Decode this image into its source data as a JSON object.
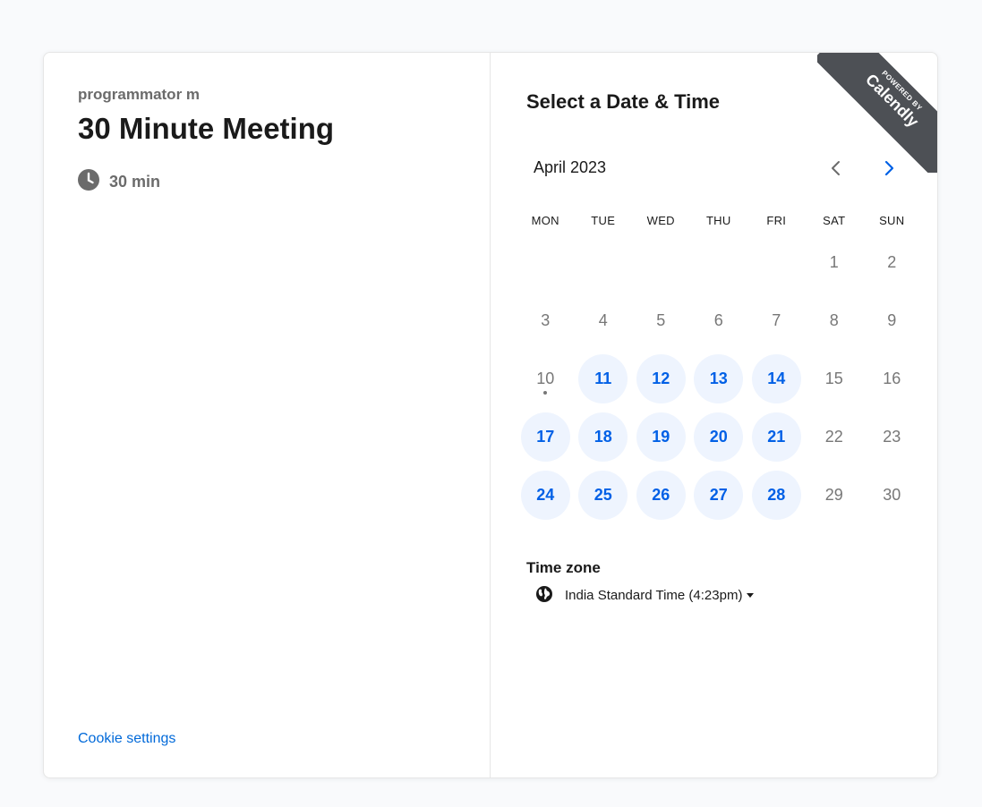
{
  "event": {
    "host": "programmator m",
    "title": "30 Minute Meeting",
    "duration": "30 min",
    "duration_icon": "clock-icon"
  },
  "footer": {
    "cookie_link": "Cookie settings"
  },
  "scheduler": {
    "title": "Select a Date & Time",
    "month": "April 2023",
    "prev_icon": "chevron-left-icon",
    "next_icon": "chevron-right-icon",
    "weekdays": [
      "MON",
      "TUE",
      "WED",
      "THU",
      "FRI",
      "SAT",
      "SUN"
    ],
    "days": [
      {
        "label": "",
        "available": false
      },
      {
        "label": "",
        "available": false
      },
      {
        "label": "",
        "available": false
      },
      {
        "label": "",
        "available": false
      },
      {
        "label": "",
        "available": false
      },
      {
        "label": "1",
        "available": false
      },
      {
        "label": "2",
        "available": false
      },
      {
        "label": "3",
        "available": false
      },
      {
        "label": "4",
        "available": false
      },
      {
        "label": "5",
        "available": false
      },
      {
        "label": "6",
        "available": false
      },
      {
        "label": "7",
        "available": false
      },
      {
        "label": "8",
        "available": false
      },
      {
        "label": "9",
        "available": false
      },
      {
        "label": "10",
        "available": false,
        "today": true
      },
      {
        "label": "11",
        "available": true
      },
      {
        "label": "12",
        "available": true
      },
      {
        "label": "13",
        "available": true
      },
      {
        "label": "14",
        "available": true
      },
      {
        "label": "15",
        "available": false
      },
      {
        "label": "16",
        "available": false
      },
      {
        "label": "17",
        "available": true
      },
      {
        "label": "18",
        "available": true
      },
      {
        "label": "19",
        "available": true
      },
      {
        "label": "20",
        "available": true
      },
      {
        "label": "21",
        "available": true
      },
      {
        "label": "22",
        "available": false
      },
      {
        "label": "23",
        "available": false
      },
      {
        "label": "24",
        "available": true
      },
      {
        "label": "25",
        "available": true
      },
      {
        "label": "26",
        "available": true
      },
      {
        "label": "27",
        "available": true
      },
      {
        "label": "28",
        "available": true
      },
      {
        "label": "29",
        "available": false
      },
      {
        "label": "30",
        "available": false
      }
    ],
    "timezone_label": "Time zone",
    "timezone_value": "India Standard Time (4:23pm)",
    "timezone_icon": "globe-icon"
  },
  "badge": {
    "small": "POWERED BY",
    "brand": "Calendly"
  },
  "colors": {
    "accent": "#0060e6",
    "available_bg": "#eef4fe",
    "ribbon": "#4d5055"
  }
}
